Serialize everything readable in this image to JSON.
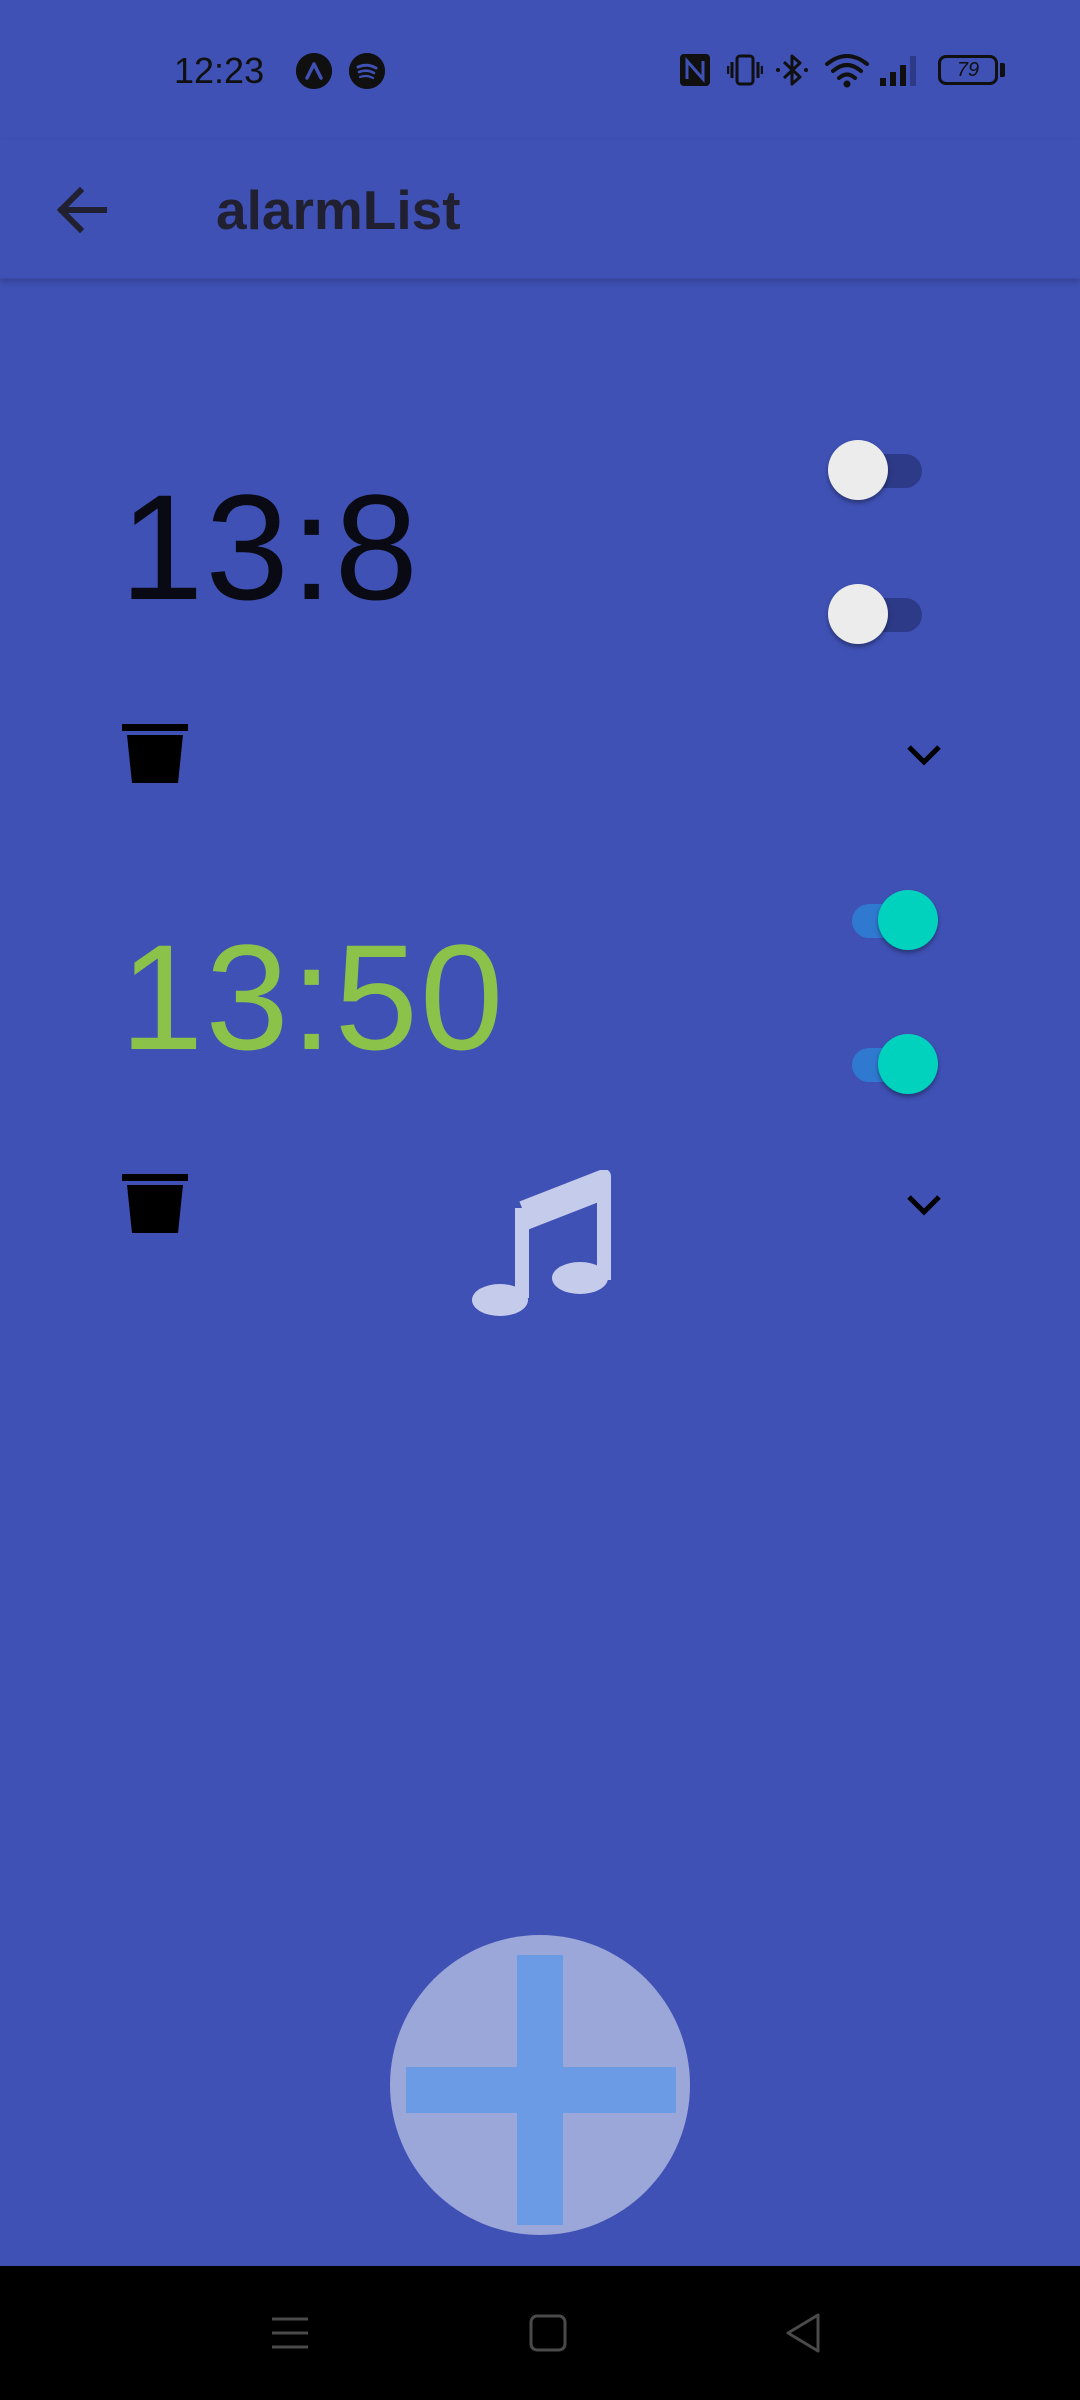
{
  "status_bar": {
    "time": "12:23",
    "app_icons": [
      "arc-app-icon",
      "spotify-icon"
    ],
    "system_icons": [
      "nfc-icon",
      "vibrate-icon",
      "bluetooth-icon",
      "wifi-icon",
      "signal-icon",
      "battery-icon"
    ],
    "battery_level": "79"
  },
  "app_bar": {
    "title": "alarmList",
    "back_icon": "arrow-back-icon"
  },
  "alarms": [
    {
      "time": "13:8",
      "time_color": "#0a0a14",
      "toggle_1_on": false,
      "toggle_2_on": false,
      "delete_icon": "trash-icon",
      "expand_icon": "chevron-down-icon"
    },
    {
      "time": "13:50",
      "time_color": "#8bc34a",
      "toggle_1_on": true,
      "toggle_2_on": true,
      "delete_icon": "trash-icon",
      "expand_icon": "chevron-down-icon",
      "sound_icon": "music-note-icon"
    }
  ],
  "fab": {
    "icon": "plus-icon"
  },
  "nav_bar": {
    "icons": [
      "menu-icon",
      "home-square-icon",
      "back-triangle-icon"
    ]
  },
  "colors": {
    "background": "#3f51b5",
    "toggle_on_thumb": "#00d2be",
    "toggle_off_thumb": "#ececec",
    "fab_fill": "#9ba6d9",
    "fab_plus": "#6c9be6"
  }
}
